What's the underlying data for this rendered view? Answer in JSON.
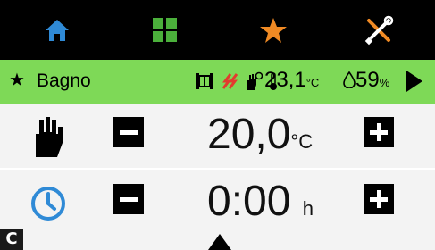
{
  "colors": {
    "topbar": "#000000",
    "home": "#2f8ad6",
    "grid": "#4bb03b",
    "favorite": "#f08a24",
    "tools": "#ffffff",
    "statusbar": "#7ed957",
    "clock": "#2f8ad6"
  },
  "nav": {
    "tabs": [
      {
        "icon": "home-icon"
      },
      {
        "icon": "grid-icon"
      },
      {
        "icon": "star-icon"
      },
      {
        "icon": "tools-icon"
      }
    ]
  },
  "status": {
    "room": "Bagno",
    "temperature": "23,1",
    "temperature_unit": "°C",
    "humidity": "59",
    "humidity_unit": "%"
  },
  "setpoint": {
    "value": "20,0",
    "unit": "°C",
    "mode_icon": "hand-icon"
  },
  "timer": {
    "value": "0:00",
    "unit": "h",
    "icon": "clock-icon"
  },
  "corner_label": "C"
}
